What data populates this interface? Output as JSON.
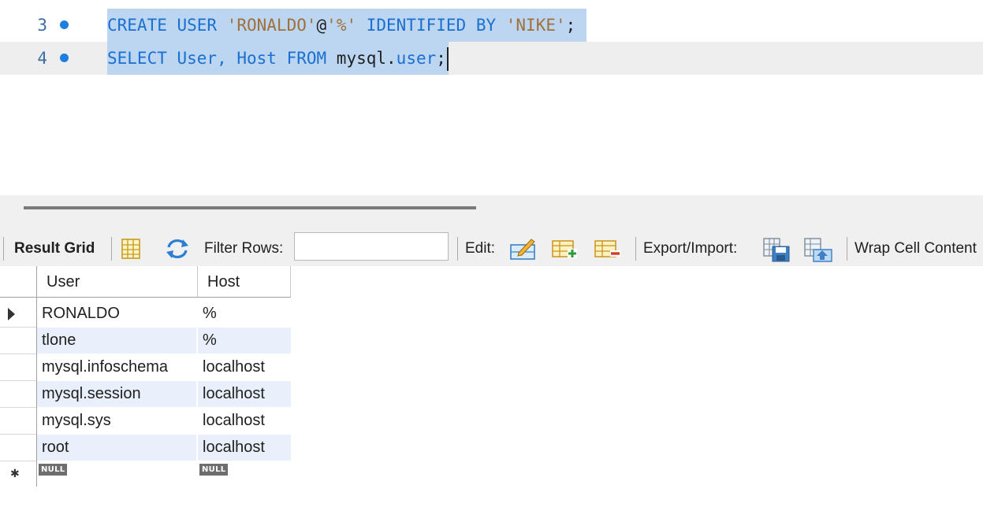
{
  "editor": {
    "lines": [
      {
        "number": "3",
        "tokens": {
          "t1": "CREATE USER ",
          "t2": "'RONALDO'",
          "t3": "@",
          "t4": "'%'",
          "t5": " IDENTIFIED BY ",
          "t6": "'NIKE'",
          "t7": ";"
        }
      },
      {
        "number": "4",
        "tokens": {
          "t1": "SELECT User, Host FROM ",
          "t2": "mysql",
          "t3": ".",
          "t4": "user",
          "t5": ";"
        }
      }
    ]
  },
  "toolbar": {
    "result_grid_label": "Result Grid",
    "filter_rows_label": "Filter Rows:",
    "filter_value": "",
    "edit_label": "Edit:",
    "export_import_label": "Export/Import:",
    "wrap_label": "Wrap Cell Content"
  },
  "grid": {
    "columns": [
      "User",
      "Host"
    ],
    "rows": [
      {
        "user": "RONALDO",
        "host": "%"
      },
      {
        "user": "tlone",
        "host": "%"
      },
      {
        "user": "mysql.infoschema",
        "host": "localhost"
      },
      {
        "user": "mysql.session",
        "host": "localhost"
      },
      {
        "user": "mysql.sys",
        "host": "localhost"
      },
      {
        "user": "root",
        "host": "localhost"
      }
    ],
    "new_row": {
      "user": "NULL",
      "host": "NULL"
    }
  },
  "icons": {
    "bullet": "breakpoint-dot-icon",
    "form_editor": "form-editor-icon",
    "refresh": "refresh-icon",
    "edit_cell": "edit-cell-icon",
    "insert_row": "insert-row-icon",
    "delete_row": "delete-row-icon",
    "export": "export-icon",
    "import": "import-icon",
    "current_row": "current-row-arrow-icon",
    "new_row": "new-row-star-icon"
  },
  "colors": {
    "keyword": "#1a6fd0",
    "string": "#a0703a",
    "selection": "#bcd6f1",
    "alt_row": "#e9f0fb"
  }
}
